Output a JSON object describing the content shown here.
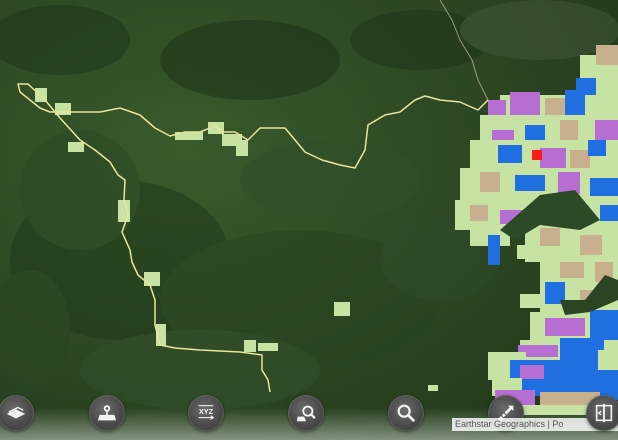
{
  "map": {
    "basemap": "satellite-imagery",
    "colors": {
      "forest_dark": "#1f3a1a",
      "forest": "#2d4a24",
      "boundary": "#e7e69a",
      "parcel_green": "#c6e3a3",
      "parcel_purple": "#b66ed2",
      "parcel_blue": "#1f6fe0",
      "parcel_tan": "#c8b08e",
      "parcel_red": "#ff1a1a"
    }
  },
  "toolbar": {
    "tools": [
      {
        "name": "basemap-tool-button",
        "icon": "layers-icon"
      },
      {
        "name": "area-tool-button",
        "icon": "map-pin-area-icon"
      },
      {
        "name": "coordinates-tool-button",
        "icon": "xyz-icon",
        "label": "XYZ"
      },
      {
        "name": "map-search-tool-button",
        "icon": "map-search-icon"
      },
      {
        "name": "search-tool-button",
        "icon": "search-icon"
      },
      {
        "name": "measure-tool-button",
        "icon": "measure-icon"
      },
      {
        "name": "swipe-tool-button",
        "icon": "swipe-compare-icon"
      }
    ]
  },
  "attribution": {
    "text": "Earthstar Geographics | Po"
  }
}
